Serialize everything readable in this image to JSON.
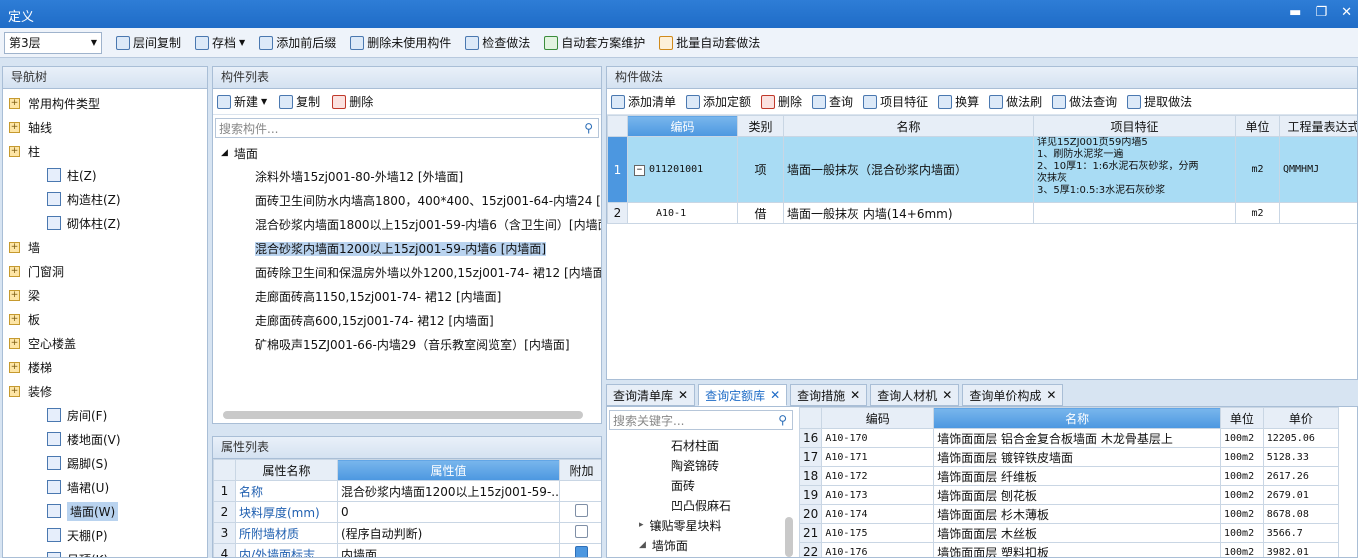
{
  "window": {
    "title": "定义",
    "min": "▬",
    "restore": "❐",
    "close": "✕"
  },
  "toolbar": {
    "floor": "第3层",
    "buttons": [
      "层间复制",
      "存档",
      "添加前后缀",
      "删除未使用构件",
      "检查做法",
      "自动套方案维护",
      "批量自动套做法"
    ]
  },
  "nav": {
    "title": "导航树",
    "items": [
      {
        "label": "常用构件类型",
        "level": 0
      },
      {
        "label": "轴线",
        "level": 0
      },
      {
        "label": "柱",
        "level": 0
      },
      {
        "label": "柱(Z)",
        "level": 1
      },
      {
        "label": "构造柱(Z)",
        "level": 1
      },
      {
        "label": "砌体柱(Z)",
        "level": 1
      },
      {
        "label": "墙",
        "level": 0
      },
      {
        "label": "门窗洞",
        "level": 0
      },
      {
        "label": "梁",
        "level": 0
      },
      {
        "label": "板",
        "level": 0
      },
      {
        "label": "空心楼盖",
        "level": 0
      },
      {
        "label": "楼梯",
        "level": 0
      },
      {
        "label": "装修",
        "level": 0
      },
      {
        "label": "房间(F)",
        "level": 1
      },
      {
        "label": "楼地面(V)",
        "level": 1
      },
      {
        "label": "踢脚(S)",
        "level": 1
      },
      {
        "label": "墙裙(U)",
        "level": 1
      },
      {
        "label": "墙面(W)",
        "level": 1,
        "selected": true
      },
      {
        "label": "天棚(P)",
        "level": 1
      },
      {
        "label": "吊顶(K)",
        "level": 1
      }
    ]
  },
  "component_list": {
    "title": "构件列表",
    "new_label": "新建",
    "copy_label": "复制",
    "delete_label": "删除",
    "search_placeholder": "搜索构件...",
    "group": "墙面",
    "items": [
      "涂料外墙15zj001-80-外墙12 [外墙面]",
      "面砖卫生间防水内墙高1800，400*400、15zj001-64-内墙24 [内",
      "混合砂浆内墙面1800以上15zj001-59-内墙6（含卫生间）[内墙面",
      "混合砂浆内墙面1200以上15zj001-59-内墙6 [内墙面]",
      "面砖除卫生间和保温房外墙以外1200,15zj001-74- 裙12 [内墙面]",
      "走廊面砖高1150,15zj001-74- 裙12 [内墙面]",
      "走廊面砖高600,15zj001-74- 裙12 [内墙面]",
      "矿棉吸声15ZJ001-66-内墙29（音乐教室阅览室）[内墙面]"
    ],
    "selected_index": 3
  },
  "properties": {
    "title": "属性列表",
    "headers": [
      "属性名称",
      "属性值",
      "附加"
    ],
    "rows": [
      {
        "num": "1",
        "name": "名称",
        "value": "混合砂浆内墙面1200以上15zj001-59-...",
        "checked": null
      },
      {
        "num": "2",
        "name": "块料厚度(mm)",
        "value": "0",
        "checked": false
      },
      {
        "num": "3",
        "name": "所附墙材质",
        "value": "(程序自动判断)",
        "checked": false
      },
      {
        "num": "4",
        "name": "内/外墙面标志",
        "value": "内墙面",
        "checked": true
      }
    ]
  },
  "methods": {
    "title": "构件做法",
    "toolbar": [
      "添加清单",
      "添加定额",
      "删除",
      "查询",
      "项目特征",
      "换算",
      "做法刷",
      "做法查询",
      "提取做法"
    ],
    "headers": [
      "编码",
      "类别",
      "名称",
      "项目特征",
      "单位",
      "工程量表达式"
    ],
    "rows": [
      {
        "num": "1",
        "code": "011201001",
        "type": "项",
        "name": "墙面一般抹灰（混合砂浆内墙面）",
        "features": [
          "详见15ZJ001页59内墙5",
          "1、刷防水泥浆一遍",
          "2、10厚1：1:6水泥石灰砂浆，分两",
          "次抹灰",
          "3、5厚1:0.5:3水泥石灰砂浆"
        ],
        "unit": "m2",
        "expr": "QMMHMJ"
      },
      {
        "num": "2",
        "code": "A10-1",
        "type": "借",
        "name": "墙面一般抹灰 内墙(14+6mm)",
        "features": [],
        "unit": "m2",
        "expr": ""
      }
    ]
  },
  "query": {
    "tabs": [
      "查询清单库",
      "查询定额库",
      "查询措施",
      "查询人材机",
      "查询单价构成"
    ],
    "active_tab": 1,
    "search_placeholder": "搜索关键字...",
    "tree": [
      {
        "label": "石材柱面",
        "level": 2
      },
      {
        "label": "陶瓷锦砖",
        "level": 2
      },
      {
        "label": "面砖",
        "level": 2
      },
      {
        "label": "凹凸假麻石",
        "level": 2
      },
      {
        "label": "镶贴零星块料",
        "level": 1,
        "arrow": "▸"
      },
      {
        "label": "墙饰面",
        "level": 1,
        "arrow": "◢"
      }
    ],
    "headers": [
      "编码",
      "名称",
      "单位",
      "单价"
    ],
    "rows": [
      {
        "num": "16",
        "code": "A10-170",
        "name": "墙饰面面层 铝合金复合板墙面 木龙骨基层上",
        "unit": "100m2",
        "price": "12205.06"
      },
      {
        "num": "17",
        "code": "A10-171",
        "name": "墙饰面面层 镀锌铁皮墙面",
        "unit": "100m2",
        "price": "5128.33"
      },
      {
        "num": "18",
        "code": "A10-172",
        "name": "墙饰面面层 纤维板",
        "unit": "100m2",
        "price": "2617.26"
      },
      {
        "num": "19",
        "code": "A10-173",
        "name": "墙饰面面层 刨花板",
        "unit": "100m2",
        "price": "2679.01"
      },
      {
        "num": "20",
        "code": "A10-174",
        "name": "墙饰面面层 杉木薄板",
        "unit": "100m2",
        "price": "8678.08"
      },
      {
        "num": "21",
        "code": "A10-175",
        "name": "墙饰面面层 木丝板",
        "unit": "100m2",
        "price": "3566.7"
      },
      {
        "num": "22",
        "code": "A10-176",
        "name": "墙饰面面层 塑料扣板",
        "unit": "100m2",
        "price": "3982.01"
      }
    ]
  }
}
